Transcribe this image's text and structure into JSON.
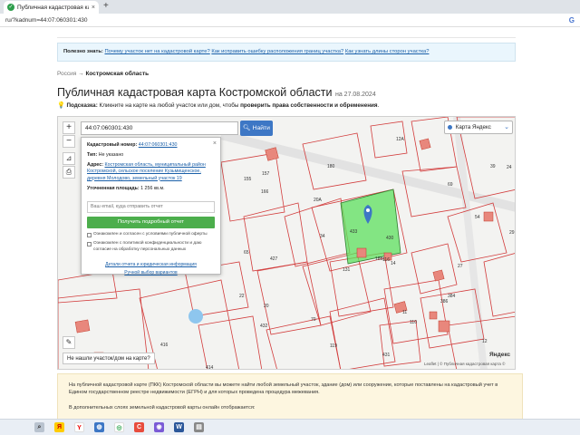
{
  "browser": {
    "tab_title": "Публичная кадастровая карта",
    "tab_close": "×",
    "new_tab": "+",
    "url": "ru/?kadnum=44:07:060301:430",
    "google": "G"
  },
  "info_strip": {
    "prefix": "Полезно знать:",
    "link1": "Почему участок нет на кадастровой карте?",
    "link2": "Как исправить ошибку расположения границ участка?",
    "link3": "Как узнать длины сторон участка?"
  },
  "breadcrumb": {
    "root": "Россия",
    "sep": "→",
    "current": "Костромская область"
  },
  "title": {
    "text": "Публичная кадастровая карта Костромской области",
    "date": "на 27.08.2024"
  },
  "hint": {
    "label": "Подсказка:",
    "text": "Кликните на карте на любой участок или дом, чтобы",
    "bold": "проверить права собственности и обременения",
    "end": "."
  },
  "map": {
    "search_value": "44:07:060301:430",
    "find_label": "Найти",
    "layer_label": "Карта Яндекс",
    "zoom_in": "+",
    "zoom_out": "−",
    "not_found": "Не нашли участок/дом на карте?",
    "copyright": "Leaflet | © Публичная кадастровая карта ©",
    "yandex": "Яндекс",
    "parcel_labels": [
      "12А",
      "157",
      "155",
      "180",
      "166",
      "20А",
      "34",
      "433",
      "430",
      "18Б",
      "14",
      "131",
      "427",
      "65",
      "22",
      "20",
      "384",
      "432",
      "70",
      "116",
      "119",
      "431",
      "414",
      "416",
      "38",
      "39",
      "69",
      "24",
      "54",
      "29",
      "27",
      "11",
      "110",
      "386",
      "12"
    ],
    "popup": {
      "close": "×",
      "cad_label": "Кадастровый номер:",
      "cad_value": "44:07:060301:430",
      "type_label": "Тип:",
      "type_value": "Не указано",
      "addr_label": "Адрес:",
      "addr_value": "Костромская область, муниципальный район Костромской, сельское поселение Кузьмищенское, деревня Молодово, земельный участок 19",
      "area_label": "Уточненная площадь:",
      "area_value": "1 256 кв.м.",
      "email_placeholder": "Ваш email, куда отправить отчет",
      "report_button": "Получить подробный отчет",
      "check1": "Ознакомлен и согласен с условиями публичной оферты",
      "check2": "Ознакомлен с политикой конфиденциальности и даю согласие на обработку персональных данных",
      "link_details": "Детали отчета и юридическая информация",
      "link_boundaries": "Ручной выбор вариантов"
    }
  },
  "description": {
    "p1": "На публичной кадастровой карте (ПКК) Костромской области вы можете найти любой земельный участок, здание (дом) или сооружение, которые поставлены на кадастровый учет в Едином государственном реестре недвижимости (ЕГРН) и для которых проведена процедура межевания.",
    "p2": "В дополнительных слоях земельной кадастровой карты онлайн отображается:"
  },
  "colors": {
    "accent": "#3d77c5",
    "report_green": "#4cae4c",
    "selected_parcel": "#5ee05e",
    "parcel_border": "#d23c3c"
  }
}
